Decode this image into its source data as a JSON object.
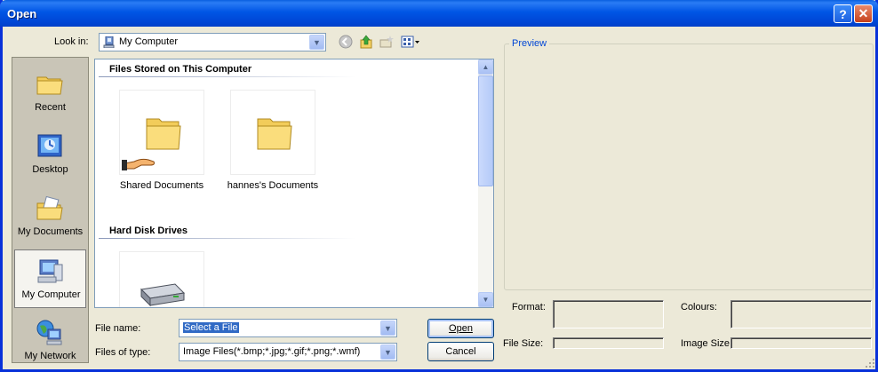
{
  "window": {
    "title": "Open"
  },
  "titlebar": {
    "help_glyph": "?",
    "close_glyph": "✕"
  },
  "lookin": {
    "label": "Look in:",
    "value": "My Computer"
  },
  "toolbar": {
    "icons": [
      "back-icon",
      "up-folder-icon",
      "new-folder-icon",
      "views-menu-icon"
    ]
  },
  "places": [
    {
      "label": "Recent",
      "icon": "recent-folder-icon"
    },
    {
      "label": "Desktop",
      "icon": "desktop-icon"
    },
    {
      "label": "My Documents",
      "icon": "my-documents-icon"
    },
    {
      "label": "My Computer",
      "icon": "my-computer-icon",
      "selected": true
    },
    {
      "label": "My Network",
      "icon": "my-network-icon"
    }
  ],
  "filelist": {
    "groups": [
      {
        "title": "Files Stored on This Computer",
        "items": [
          {
            "label": "Shared Documents",
            "icon": "shared-folder-icon"
          },
          {
            "label": "hannes's Documents",
            "icon": "folder-icon"
          }
        ]
      },
      {
        "title": "Hard Disk Drives",
        "items": [
          {
            "label": "",
            "icon": "hard-drive-icon"
          }
        ]
      }
    ]
  },
  "filename": {
    "label": "File name:",
    "value": "Select a File"
  },
  "filetype": {
    "label": "Files of type:",
    "value": "Image Files(*.bmp;*.jpg;*.gif;*.png;*.wmf)"
  },
  "buttons": {
    "open": "Open",
    "cancel": "Cancel"
  },
  "preview": {
    "legend": "Preview",
    "format_label": "Format:",
    "colours_label": "Colours:",
    "filesize_label": "File Size:",
    "imagesize_label": "Image Size:"
  },
  "colors": {
    "title_bar": "#0055e5",
    "dialog_bg": "#ece9d8",
    "accent_blue": "#316ac5",
    "legend_blue": "#0046d5"
  }
}
